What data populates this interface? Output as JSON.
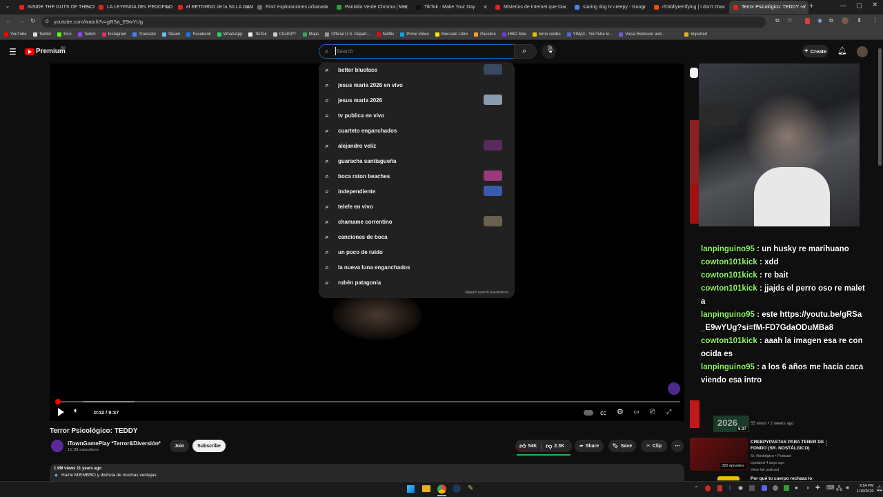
{
  "tabs": [
    {
      "label": "INSIDE THE GUTS OF THE CRA",
      "color": "#e62117"
    },
    {
      "label": "LA LEYENDA DEL PEDOFILO D",
      "color": "#e62117"
    },
    {
      "label": "el RETORNO de la SILLA GAM",
      "color": "#e62117"
    },
    {
      "label": "Find 'exploraciones urbanas'",
      "color": "#6a6a6a"
    },
    {
      "label": "Pantalla Verde Chroma | Mer",
      "color": "#2ea043"
    },
    {
      "label": "TikTok - Make Your Day",
      "color": "#111111"
    },
    {
      "label": "Misterios de Internet que Du",
      "color": "#e62117"
    },
    {
      "label": "staring dog tv creepy - Goog",
      "color": "#4285f4"
    },
    {
      "label": "r/Oddlyterrifying | I don't Ow",
      "color": "#ff4500"
    },
    {
      "label": "Terror Psicológico: TEDDY - Y",
      "color": "#e62117"
    }
  ],
  "url": "youtube.com/watch?v=gRSa_E9wYUg",
  "bookmarks": [
    "YouTube",
    "Twitter",
    "Kick",
    "Twitch",
    "Instagram",
    "Translate",
    "Steam",
    "Facebook",
    "WhatsApp",
    "TikTok",
    "ChatGPT",
    "Maps",
    "Official U.S. Depart...",
    "Netflix",
    "Prime Video",
    "Mercado Libre",
    "Passline",
    "HBO Max",
    "turno recibo",
    "YtMp3 - YouTube to...",
    "Vocal Remover and...",
    "Imported"
  ],
  "header": {
    "logo_text": "Premium",
    "logo_badge": "AR",
    "search_placeholder": "Search",
    "create_label": "Create"
  },
  "suggestions": [
    {
      "text": "better blueface",
      "thumb": "#3a4a5e"
    },
    {
      "text": "jesus maria 2026 en vivo",
      "thumb": ""
    },
    {
      "text": "jesus maria 2026",
      "thumb": "#8a9cb0"
    },
    {
      "text": "tv publica en vivo",
      "thumb": ""
    },
    {
      "text": "cuarteto enganchados",
      "thumb": ""
    },
    {
      "text": "alejandro veliz",
      "thumb": "#5a2a5e"
    },
    {
      "text": "guaracha santiagueña",
      "thumb": ""
    },
    {
      "text": "boca raton beaches",
      "thumb": "#9a3a7a"
    },
    {
      "text": "independiente",
      "thumb": "#3a5ab0"
    },
    {
      "text": "telefe en vivo",
      "thumb": ""
    },
    {
      "text": "chamame correntino",
      "thumb": "#6a6050"
    },
    {
      "text": "canciones de boca",
      "thumb": ""
    },
    {
      "text": "un poco de ruido",
      "thumb": ""
    },
    {
      "text": "la nueva luna enganchados",
      "thumb": ""
    },
    {
      "text": "rubén patagonia",
      "thumb": ""
    }
  ],
  "report_predictions": "Report search predictions",
  "player": {
    "time": "0:02 / 9:37",
    "progress": 0.01
  },
  "video": {
    "title": "Terror Psicológico: TEDDY",
    "channel": "iTownGamePlay *Terror&Diversión*",
    "subscribers": "15.1M subscribers",
    "join": "Join",
    "subscribe": "Subscribe",
    "likes": "54K",
    "dislikes": "2.3K",
    "share": "Share",
    "save": "Save",
    "clip": "Clip",
    "views": "1.9M views  11 years ago",
    "desc": "Hazte MIEMBRO y disfruta de muchas ventajas:"
  },
  "chat": [
    {
      "user": "lanpinguino95",
      "msg": "un husky re marihuano"
    },
    {
      "user": "cowton101kick",
      "msg": "xdd"
    },
    {
      "user": "cowton101kick",
      "msg": "re bait"
    },
    {
      "user": "cowton101kick",
      "msg": "jjajds el perro oso re maleta"
    },
    {
      "user": "lanpinguino95",
      "msg": "este https://youtu.be/gRSa_E9wYUg?si=fM-FD7GdaODuMBa8"
    },
    {
      "user": "cowton101kick",
      "msg": "aaah la imagen esa re conocida es"
    },
    {
      "user": "lanpinguino95",
      "msg": "a los 6 años me hacia caca viendo esa intro"
    }
  ],
  "sidebar": {
    "video1_time": "5:37",
    "video1_meta": "55 views • 2 weeks ago",
    "playlist_title": "CREEPYPASTAS PARA TENER DE FONDO (SR. NOSTÁLGICO)",
    "playlist_channel": "Sr. Nostálgico • Podcast",
    "playlist_updated": "Updated 4 days ago",
    "playlist_view": "View full podcast",
    "playlist_count": "320 episodes",
    "next_title": "Por qué tu cuerpo rechaza lo",
    "year_label": "2026"
  },
  "clock": {
    "time": "9:54 PM",
    "date": "1/19/2026"
  }
}
